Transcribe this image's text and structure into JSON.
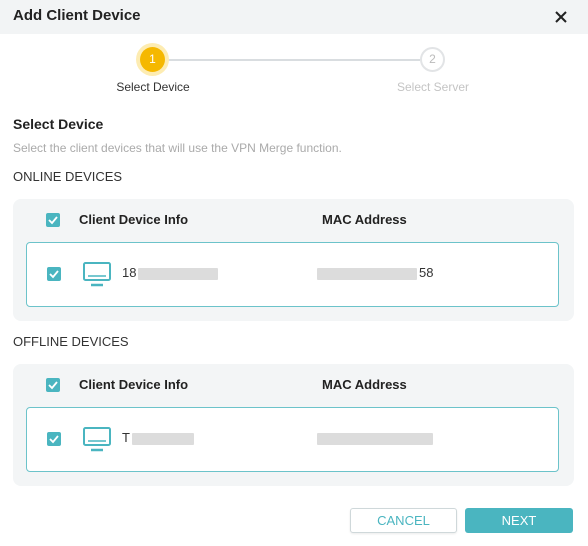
{
  "header": {
    "title": "Add Client Device",
    "close_icon": "close-icon"
  },
  "stepper": {
    "steps": [
      {
        "number": "1",
        "label": "Select Device",
        "state": "active"
      },
      {
        "number": "2",
        "label": "Select Server",
        "state": "inactive"
      }
    ],
    "active_color": "#f5b800"
  },
  "section": {
    "title": "Select Device",
    "description": "Select the client devices that will use the VPN Merge function."
  },
  "online": {
    "label": "ONLINE DEVICES",
    "columns": [
      "Client Device Info",
      "MAC Address"
    ],
    "rows": [
      {
        "name_prefix": "18",
        "mac_suffix": "58",
        "checked": true
      }
    ]
  },
  "offline": {
    "label": "OFFLINE DEVICES",
    "columns": [
      "Client Device Info",
      "MAC Address"
    ],
    "rows": [
      {
        "name_prefix": "T",
        "mac_suffix": "",
        "checked": true
      }
    ]
  },
  "buttons": {
    "cancel": "CANCEL",
    "next": "NEXT"
  },
  "colors": {
    "accent": "#4ab5c0",
    "step_active": "#f5b800",
    "panel_bg": "#f3f5f6"
  }
}
